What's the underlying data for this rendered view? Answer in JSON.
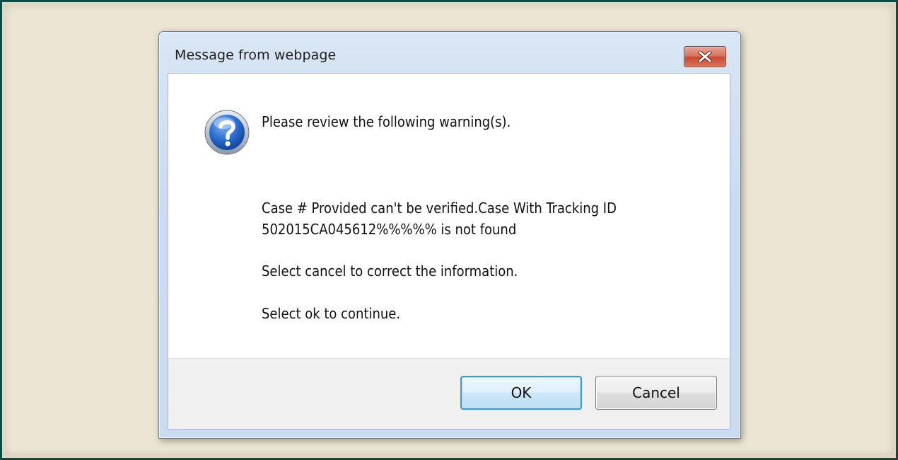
{
  "dialog": {
    "title": "Message from webpage",
    "icon": "question-icon",
    "close_icon": "close-icon",
    "message_main": "Please review the following warning(s).",
    "message_detail": "Case # Provided can't be verified.Case With Tracking ID\n502015CA045612%%%%% is not found",
    "message_cancel_hint": "Select cancel to correct the information.",
    "message_ok_hint": "Select ok to continue.",
    "ok_label": "OK",
    "cancel_label": "Cancel"
  },
  "colors": {
    "backdrop": "#ece5d3",
    "frame_border": "#0f4a44",
    "close_button": "#c74a30",
    "default_button_border": "#3c9ad8",
    "icon_blue": "#1f5fbf"
  }
}
